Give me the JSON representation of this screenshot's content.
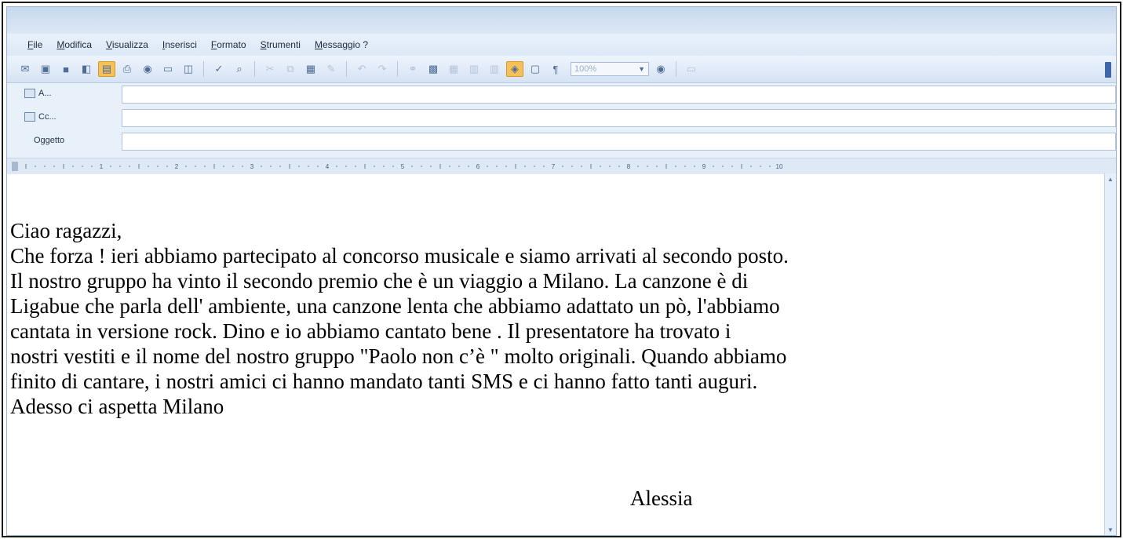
{
  "menu": [
    "File",
    "Modifica",
    "Visualizza",
    "Inserisci",
    "Formato",
    "Strumenti",
    "Messaggio ?"
  ],
  "toolbar": {
    "zoom_value": "100%"
  },
  "header_fields": {
    "to_label": "A...",
    "cc_label": "Cc...",
    "subject_label": "Oggetto",
    "to_value": "",
    "cc_value": "",
    "subject_value": ""
  },
  "ruler": {
    "numbers": [
      "1",
      "2",
      "3",
      "4",
      "5",
      "6",
      "7",
      "8",
      "9",
      "10"
    ]
  },
  "message": {
    "lines": [
      "Ciao  ragazzi,",
      "Che forza ! ieri abbiamo partecipato al concorso musicale e siamo arrivati al secondo posto.",
      "Il nostro gruppo ha vinto il secondo premio  che è un viaggio a Milano. La canzone è di",
      "Ligabue che parla dell' ambiente, una canzone lenta che abbiamo adattato un pò, l'abbiamo",
      "cantata  in versione rock. Dino e io abbiamo  cantato  bene . Il presentatore ha trovato  i",
      "nostri vestiti e il nome del nostro gruppo \"Paolo non c’è \" molto originali. Quando abbiamo",
      "finito di cantare, i nostri amici ci  hanno mandato tanti SMS e ci hanno fatto tanti auguri.",
      "Adesso ci aspetta Milano"
    ],
    "signature": "Alessia"
  },
  "colors": {
    "window_bg": "#e8f0fa",
    "toolbar_active": "#f6c15a",
    "field_border": "#b3c5de"
  }
}
